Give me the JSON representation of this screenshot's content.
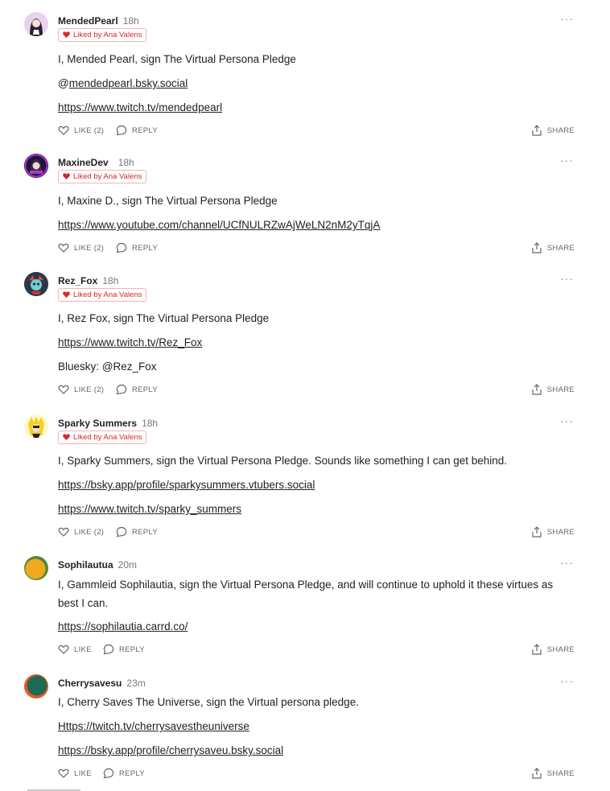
{
  "liked_label": "Liked by Ana Valens",
  "actions": {
    "reply": "REPLY",
    "share": "SHARE"
  },
  "menu_glyph": "···",
  "comments": [
    {
      "author": "MendedPearl",
      "time": "18h",
      "liked": true,
      "like": "LIKE (2)",
      "lines": [
        "I, Mended Pearl, sign The Virtual Persona Pledge",
        "@",
        "mendedpearl.bsky.social",
        "https://www.twitch.tv/mendedpearl"
      ]
    },
    {
      "author": "MaxineDev",
      "time": "18h",
      "liked": true,
      "like": "LIKE (2)",
      "lines": [
        "I, Maxine D., sign The Virtual Persona Pledge",
        "https://www.youtube.com/channel/UCfNULRZwAjWeLN2nM2yTqjA"
      ]
    },
    {
      "author": "Rez_Fox",
      "time": "18h",
      "liked": true,
      "like": "LIKE (2)",
      "lines": [
        "I, Rez Fox, sign The Virtual Persona Pledge",
        "https://www.twitch.tv/Rez_Fox",
        "Bluesky: @Rez_Fox"
      ]
    },
    {
      "author": "Sparky Summers",
      "time": "18h",
      "liked": true,
      "like": "LIKE (2)",
      "lines": [
        "I, Sparky Summers, sign the Virtual Persona Pledge. Sounds like something I can get behind.",
        "https://bsky.app/profile/sparkysummers.vtubers.social",
        "https://www.twitch.tv/sparky_summers"
      ]
    },
    {
      "author": "Sophilautua",
      "time": "20m",
      "liked": false,
      "like": "LIKE",
      "lines": [
        "I, Gammleid Sophilautia, sign the Virtual Persona Pledge, and will continue to uphold it these virtues as best I can.",
        "https://sophilautia.carrd.co/"
      ]
    },
    {
      "author": "Cherrysavesu",
      "time": "23m",
      "liked": false,
      "like": "LIKE",
      "lines": [
        "I, Cherry Saves The Universe, sign the Virtual persona pledge.",
        "Https://twitch.tv/cherrysavestheuniverse",
        "https://bsky.app/profile/cherrysaveu.bsky.social"
      ]
    }
  ]
}
